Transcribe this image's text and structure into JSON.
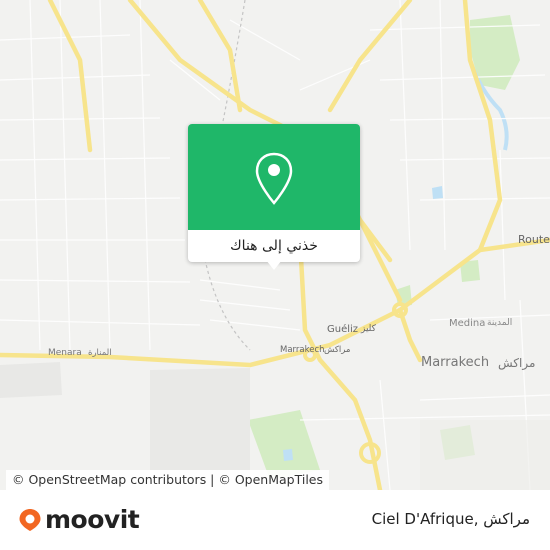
{
  "map": {
    "labels": {
      "route": "Route",
      "gueliz": "Guéliz",
      "gueliz_ar": "كليز",
      "medina": "Medina",
      "medina_ar": "المدينة",
      "marrakech": "Marrakech",
      "marrakech_ar": "مراكش",
      "marrakech_road": "Marrakech",
      "marrakech_road_ar": "مراكش",
      "menara": "Menara",
      "menara_ar": "المنارة"
    },
    "colors": {
      "road": "#f7e48c",
      "park": "#d4ecc4",
      "water": "#bfe0f5",
      "land": "#f2f2f0"
    }
  },
  "popup": {
    "button_label": "خذني إلى هناك",
    "icon": "map-pin-icon",
    "color": "#1fb769"
  },
  "attribution": "© OpenStreetMap contributors | © OpenMapTiles",
  "footer": {
    "brand": "moovit",
    "brand_color": "#f26722",
    "place_name": "Ciel D'Afrique, مراكش"
  }
}
